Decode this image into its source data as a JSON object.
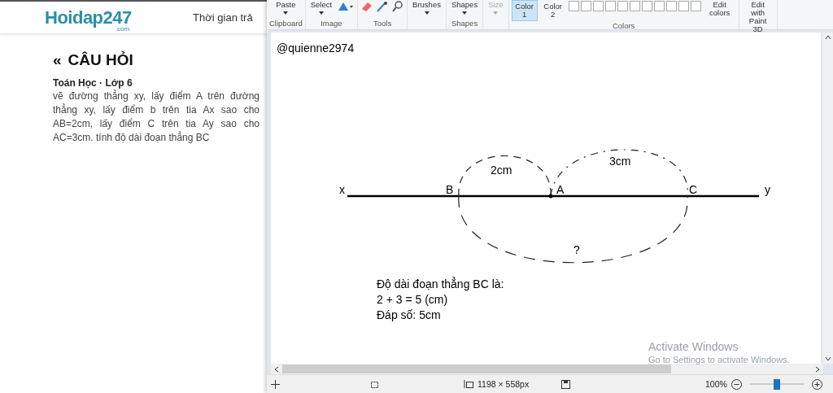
{
  "web_page": {
    "logo": {
      "name": "Hoidap247",
      "domain": ".com"
    },
    "nav_link": "Thời gian trả",
    "back_icon": "«",
    "heading": "CÂU HỎI",
    "meta": "Toán Học · Lớp 6",
    "question": "vẽ đường thẳng xy, lấy điểm A trên đường thẳng xy, lấy điểm b trên tia Ax sao cho AB=2cm, lấy điểm C trên tia Ay sao cho AC=3cm. tính độ dài đoạn thẳng BC"
  },
  "paint": {
    "ribbon": [
      {
        "label": "Clipboard",
        "items": [
          {
            "kind": "dropdown",
            "label": "Paste",
            "disabled": false
          }
        ]
      },
      {
        "label": "Image",
        "items": [
          {
            "kind": "dropdown",
            "label": "Select",
            "disabled": false
          },
          {
            "kind": "rotate"
          }
        ]
      },
      {
        "label": "Tools",
        "items": [
          {
            "kind": "eraser"
          },
          {
            "kind": "picker"
          },
          {
            "kind": "magnifier"
          }
        ]
      },
      {
        "items": [
          {
            "kind": "dropdown",
            "label": "Brushes",
            "disabled": false
          }
        ]
      },
      {
        "label": "Shapes",
        "items": [
          {
            "kind": "dropdown",
            "label": "Shapes",
            "disabled": false
          }
        ]
      },
      {
        "items": [
          {
            "kind": "dropdown",
            "label": "Size",
            "disabled": true
          }
        ]
      },
      {
        "label": "Colors",
        "items": [
          {
            "kind": "color",
            "label": "Color 1",
            "selected": true
          },
          {
            "kind": "color",
            "label": "Color 2",
            "selected": false
          },
          {
            "kind": "palette"
          },
          {
            "kind": "button",
            "label": "Edit colors"
          }
        ]
      },
      {
        "items": [
          {
            "kind": "button",
            "label": "Edit with Paint 3D"
          }
        ]
      }
    ],
    "canvas": {
      "signature": "@quienne2974",
      "points": [
        {
          "label": "x"
        },
        {
          "label": "B"
        },
        {
          "label": "A"
        },
        {
          "label": "C"
        },
        {
          "label": "y"
        }
      ],
      "measures": [
        "2cm",
        "3cm",
        "?"
      ],
      "answer": [
        "Độ dài đoạn thẳng BC là:",
        "2 + 3 = 5 (cm)",
        "Đáp số: 5cm"
      ]
    },
    "status_bar": {
      "canvas_size": "1198 × 558px",
      "zoom": "100%",
      "zoom_slider": {
        "level": 0.5
      }
    },
    "activation_notice": {
      "title": "Activate Windows",
      "message": "Go to Settings to activate Windows."
    }
  }
}
